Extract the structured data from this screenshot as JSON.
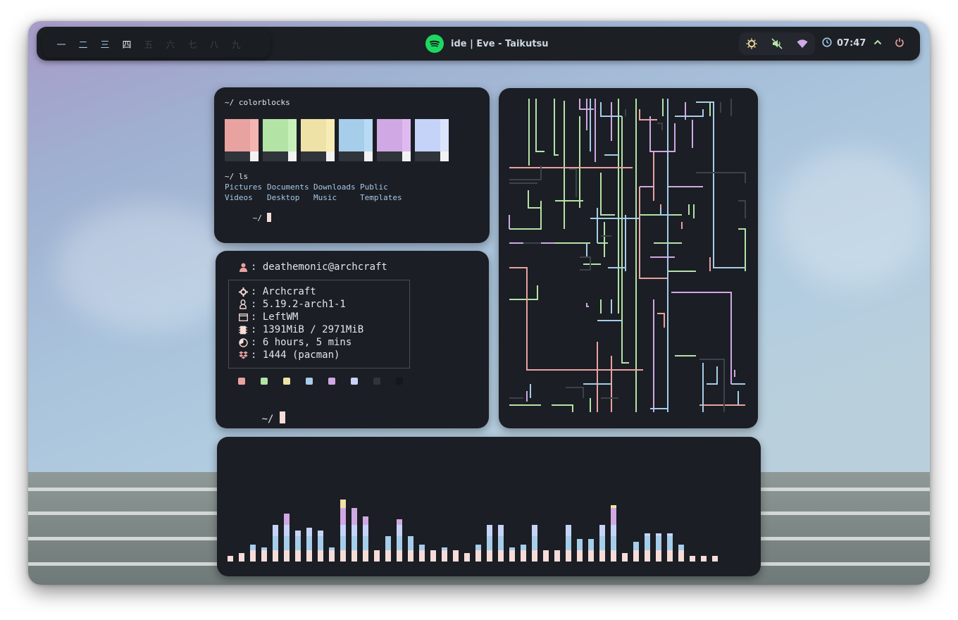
{
  "colors": {
    "red": "#e8a2a0",
    "green": "#b4e3a6",
    "yellow": "#efe2a6",
    "blue": "#a6cdea",
    "magenta": "#d0a8e3",
    "lavender": "#c6d3f8",
    "dark": "#30343b",
    "darker": "#1b1e24",
    "fg": "#e2e6ec",
    "pink": "#f6dcd8"
  },
  "topbar": {
    "workspaces": [
      "一",
      "二",
      "三",
      "四",
      "五",
      "六",
      "七",
      "八",
      "九"
    ],
    "now_playing": "ide | Eve - Taikutsu",
    "clock": "07:47",
    "tray_icons": [
      "brightness-icon",
      "volume-muted-icon",
      "wifi-icon"
    ]
  },
  "terminal1": {
    "cmd1": "~/ colorblocks",
    "cmd2": "~/ ls",
    "ls_items": [
      "Pictures",
      "Documents",
      "Downloads",
      "Public",
      "Videos",
      "Desktop",
      "Music",
      "Templates"
    ],
    "prompt": "~/"
  },
  "terminal2": {
    "user_line": ": deathemonic@archcraft",
    "rows": [
      {
        "icon": "gear-icon",
        "text": ": Archcraft"
      },
      {
        "icon": "linux-icon",
        "text": ": 5.19.2-arch1-1"
      },
      {
        "icon": "window-icon",
        "text": ": LeftWM"
      },
      {
        "icon": "memory-icon",
        "text": ": 1391MiB / 2971MiB"
      },
      {
        "icon": "uptime-icon",
        "text": ": 6 hours, 5 mins"
      },
      {
        "icon": "package-icon",
        "text": ": 1444 (pacman)"
      }
    ],
    "prompt": "~/"
  },
  "visualizer": {
    "bar_levels": [
      2,
      3,
      6,
      5,
      13,
      17,
      11,
      12,
      11,
      5,
      22,
      19,
      16,
      4,
      9,
      15,
      9,
      6,
      4,
      5,
      4,
      3,
      6,
      13,
      13,
      5,
      6,
      13,
      4,
      4,
      13,
      8,
      8,
      13,
      20,
      3,
      7,
      10,
      10,
      10,
      6,
      2,
      2,
      2
    ]
  }
}
